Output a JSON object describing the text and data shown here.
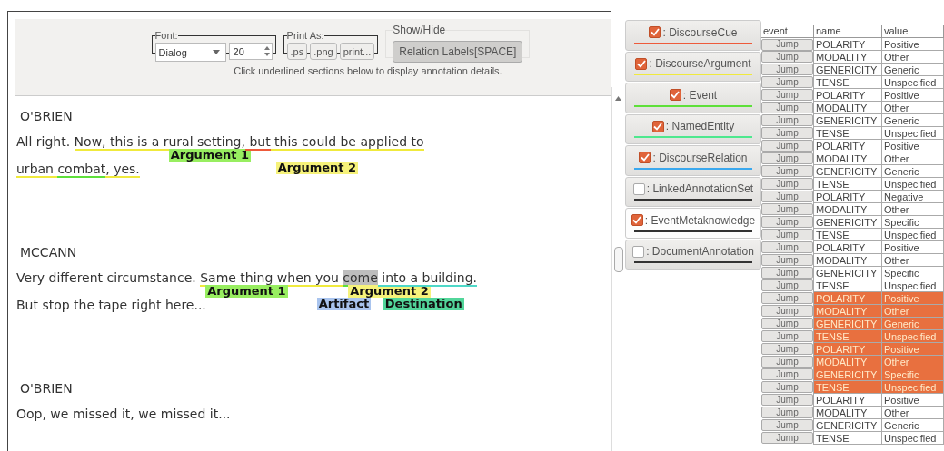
{
  "toolbar": {
    "font_group": {
      "legend": "Font:",
      "family": "Dialog",
      "size": "20"
    },
    "print_group": {
      "legend": "Print As:",
      "buttons": [
        ".ps",
        ".png",
        "print..."
      ]
    },
    "show_hide": {
      "legend": "Show/Hide",
      "button": "Relation Labels[SPACE]",
      "on": true
    },
    "hint": "Click underlined sections below to display annotation details."
  },
  "transcript": [
    {
      "speaker": "O'BRIEN",
      "lines": [
        [
          {
            "text": "All right. "
          },
          {
            "text": "Now, this is a ",
            "color": "#f0ea3c"
          },
          {
            "text": "rural setting,",
            "color": "#f0ea3c",
            "label": {
              "text": "Argument 1",
              "color": "#98ee60"
            }
          },
          {
            "text": " but",
            "color": "#ee5a3a"
          },
          {
            "text": " this could be applied to",
            "color": "#f0ea3c",
            "label": {
              "text": "Argument 2",
              "color": "#f6f27a"
            }
          }
        ],
        [
          {
            "text": "urban ",
            "color": "#f0ea3c"
          },
          {
            "text": "combat",
            "color": "#5ee03a"
          },
          {
            "text": ", yes.",
            "color": "#f0ea3c"
          }
        ]
      ]
    },
    {
      "speaker": "MCCANN",
      "lines": [
        [
          {
            "text": "Very different circumstance. "
          },
          {
            "text": "Same thing when",
            "color": "#f0ea3c",
            "label": {
              "text": "Argument 1",
              "color": "#98ee60"
            }
          },
          {
            "text": " you ",
            "color": "#f0ea3c",
            "label": {
              "text": "Artifact",
              "color": "#a9c4ee"
            }
          },
          {
            "text": "come",
            "color": "#5ee03a",
            "highlighted": true,
            "label": {
              "text": "Argument 2",
              "color": "#f6f27a"
            }
          },
          {
            "text": " into a building.",
            "color": "#4ed8c8",
            "label": {
              "text": "Destination",
              "color": "#52d69a"
            }
          }
        ],
        [
          {
            "text": "But stop the tape right here..."
          }
        ]
      ]
    },
    {
      "speaker": "O'BRIEN",
      "lines": [
        [
          {
            "text": "Oop, we missed it, we missed it..."
          }
        ]
      ]
    }
  ],
  "layers": [
    {
      "label": ": DiscourseCue",
      "checked": true,
      "color": "#ee5a3a",
      "selected": false
    },
    {
      "label": ": DiscourseArgument",
      "checked": true,
      "color": "#f0ea3c",
      "selected": false
    },
    {
      "label": ": Event",
      "checked": true,
      "color": "#5ee03a",
      "selected": false
    },
    {
      "label": ": NamedEntity",
      "checked": true,
      "color": "#4ee88e",
      "selected": false
    },
    {
      "label": ": DiscourseRelation",
      "checked": true,
      "color": "#3aa8ee",
      "selected": false
    },
    {
      "label": ": LinkedAnnotationSet",
      "checked": false,
      "color": "#333333",
      "selected": false
    },
    {
      "label": ": EventMetaknowledge",
      "checked": true,
      "color": "#333333",
      "selected": true
    },
    {
      "label": ": DocumentAnnotation",
      "checked": false,
      "color": "#333333",
      "selected": false
    }
  ],
  "table": {
    "columns": [
      "event",
      "name",
      "value"
    ],
    "rows": [
      {
        "event": "Jump",
        "name": "POLARITY",
        "value": "Positive",
        "selected": false
      },
      {
        "event": "Jump",
        "name": "MODALITY",
        "value": "Other",
        "selected": false
      },
      {
        "event": "Jump",
        "name": "GENERICITY",
        "value": "Generic",
        "selected": false
      },
      {
        "event": "Jump",
        "name": "TENSE",
        "value": "Unspecified",
        "selected": false
      },
      {
        "event": "Jump",
        "name": "POLARITY",
        "value": "Positive",
        "selected": false
      },
      {
        "event": "Jump",
        "name": "MODALITY",
        "value": "Other",
        "selected": false
      },
      {
        "event": "Jump",
        "name": "GENERICITY",
        "value": "Generic",
        "selected": false
      },
      {
        "event": "Jump",
        "name": "TENSE",
        "value": "Unspecified",
        "selected": false
      },
      {
        "event": "Jump",
        "name": "POLARITY",
        "value": "Positive",
        "selected": false
      },
      {
        "event": "Jump",
        "name": "MODALITY",
        "value": "Other",
        "selected": false
      },
      {
        "event": "Jump",
        "name": "GENERICITY",
        "value": "Generic",
        "selected": false
      },
      {
        "event": "Jump",
        "name": "TENSE",
        "value": "Unspecified",
        "selected": false
      },
      {
        "event": "Jump",
        "name": "POLARITY",
        "value": "Negative",
        "selected": false
      },
      {
        "event": "Jump",
        "name": "MODALITY",
        "value": "Other",
        "selected": false
      },
      {
        "event": "Jump",
        "name": "GENERICITY",
        "value": "Specific",
        "selected": false
      },
      {
        "event": "Jump",
        "name": "TENSE",
        "value": "Unspecified",
        "selected": false
      },
      {
        "event": "Jump",
        "name": "POLARITY",
        "value": "Positive",
        "selected": false
      },
      {
        "event": "Jump",
        "name": "MODALITY",
        "value": "Other",
        "selected": false
      },
      {
        "event": "Jump",
        "name": "GENERICITY",
        "value": "Specific",
        "selected": false
      },
      {
        "event": "Jump",
        "name": "TENSE",
        "value": "Unspecified",
        "selected": false
      },
      {
        "event": "Jump",
        "name": "POLARITY",
        "value": "Positive",
        "selected": true
      },
      {
        "event": "Jump",
        "name": "MODALITY",
        "value": "Other",
        "selected": true
      },
      {
        "event": "Jump",
        "name": "GENERICITY",
        "value": "Generic",
        "selected": true
      },
      {
        "event": "Jump",
        "name": "TENSE",
        "value": "Unspecified",
        "selected": true
      },
      {
        "event": "Jump",
        "name": "POLARITY",
        "value": "Positive",
        "selected": true
      },
      {
        "event": "Jump",
        "name": "MODALITY",
        "value": "Other",
        "selected": true
      },
      {
        "event": "Jump",
        "name": "GENERICITY",
        "value": "Specific",
        "selected": true
      },
      {
        "event": "Jump",
        "name": "TENSE",
        "value": "Unspecified",
        "selected": true
      },
      {
        "event": "Jump",
        "name": "POLARITY",
        "value": "Positive",
        "selected": false
      },
      {
        "event": "Jump",
        "name": "MODALITY",
        "value": "Other",
        "selected": false
      },
      {
        "event": "Jump",
        "name": "GENERICITY",
        "value": "Generic",
        "selected": false
      },
      {
        "event": "Jump",
        "name": "TENSE",
        "value": "Unspecified",
        "selected": false
      }
    ]
  }
}
